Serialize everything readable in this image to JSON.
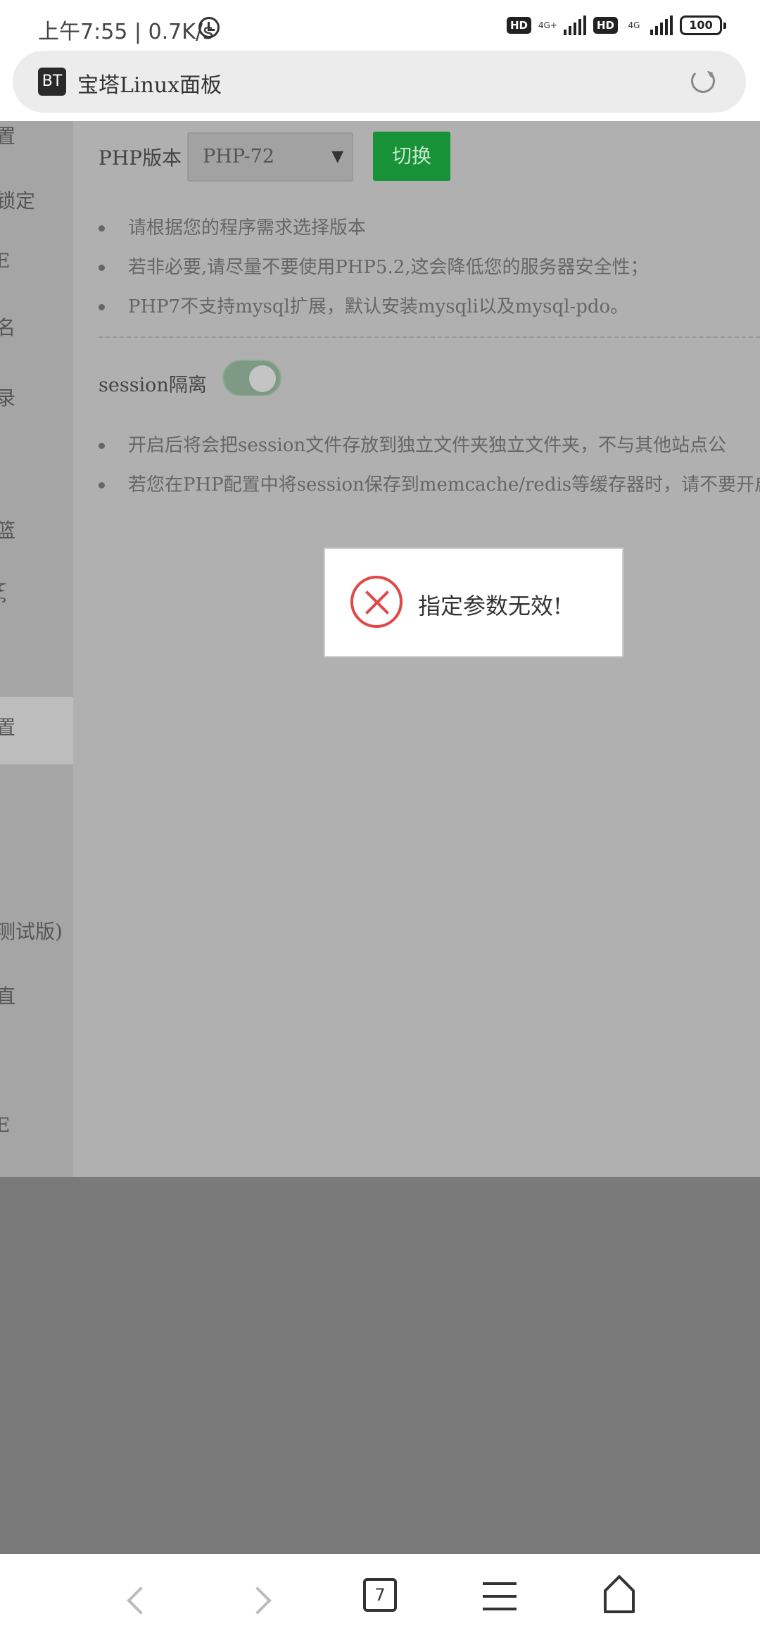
{
  "status_bar": {
    "time": "上午7:55",
    "speed": "0.7K/s",
    "hd1": "HD",
    "net1": "4G+",
    "hd2": "HD",
    "net2": "4G",
    "battery": "100"
  },
  "browser": {
    "site_icon": "BT",
    "title": "宝塔Linux面板"
  },
  "sidebar": {
    "items": [
      "置",
      "锁定",
      "E",
      "名",
      "录",
      "篮",
      "ξ",
      "置",
      "测试版)",
      "直",
      "E"
    ]
  },
  "php_version": {
    "label": "PHP版本",
    "selected": "PHP-72",
    "switch_button": "切换",
    "tips": [
      "请根据您的程序需求选择版本",
      "若非必要,请尽量不要使用PHP5.2,这会降低您的服务器安全性；",
      "PHP7不支持mysql扩展，默认安装mysqli以及mysql-pdo。"
    ]
  },
  "session": {
    "label": "session隔离",
    "enabled": true,
    "tips": [
      "开启后将会把session文件存放到独立文件夹独立文件夹，不与其他站点公",
      "若您在PHP配置中将session保存到memcache/redis等缓存器时，请不要开启"
    ]
  },
  "dialog": {
    "icon": "error-x-icon",
    "message": "指定参数无效!"
  },
  "bottom_nav": {
    "tab_count": "7"
  }
}
